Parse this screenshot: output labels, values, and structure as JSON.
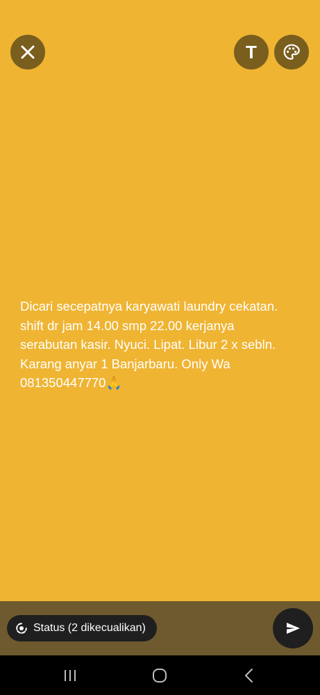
{
  "header": {
    "close_icon": "close-icon",
    "text_tool": {
      "icon": "text-icon",
      "glyph": "T"
    },
    "palette_tool": {
      "icon": "palette-icon"
    }
  },
  "status": {
    "text": "Dicari secepatnya karyawati laundry cekatan.\nshift dr jam 14.00 smp 22.00 kerjanya\nserabutan kasir. Nyuci. Lipat. Libur 2 x sebln.\nKarang anyar 1 Banjarbaru. Only Wa\n081350447770🙏",
    "background_color": "#EFB432",
    "text_color": "#FFFFFF"
  },
  "footer": {
    "audience_label": "Status (2 dikecualikan)",
    "audience_icon": "status-ring-icon",
    "send_icon": "send-icon"
  },
  "system_nav": {
    "recents_icon": "recents-icon",
    "home_icon": "home-icon",
    "back_icon": "back-icon"
  },
  "colors": {
    "accent": "#EFB432",
    "button_bg": "#7A5E1E",
    "bottom_bar": "#6E5A2E",
    "chip_bg": "#1F1F1F"
  }
}
